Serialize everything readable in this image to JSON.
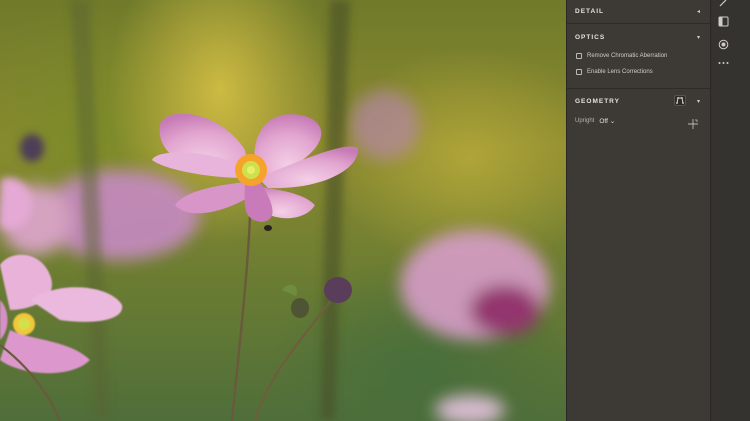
{
  "panel": {
    "detail": {
      "title": "DETAIL",
      "collapsed": true
    },
    "optics": {
      "title": "OPTICS",
      "options": [
        {
          "label": "Remove Chromatic Aberration",
          "checked": false
        },
        {
          "label": "Enable Lens Corrections",
          "checked": false
        }
      ]
    },
    "geometry": {
      "title": "GEOMETRY",
      "upright_label": "Upright",
      "upright_value": "Off",
      "upright_caret": "⌄"
    }
  },
  "icons": {
    "detail_arrow": "◂",
    "optics_arrow": "▾",
    "geometry_arrow": "▾"
  },
  "colors": {
    "panel_bg": "#3d3a36",
    "toolbar_bg": "#35332f",
    "text": "#d8d5cf"
  }
}
